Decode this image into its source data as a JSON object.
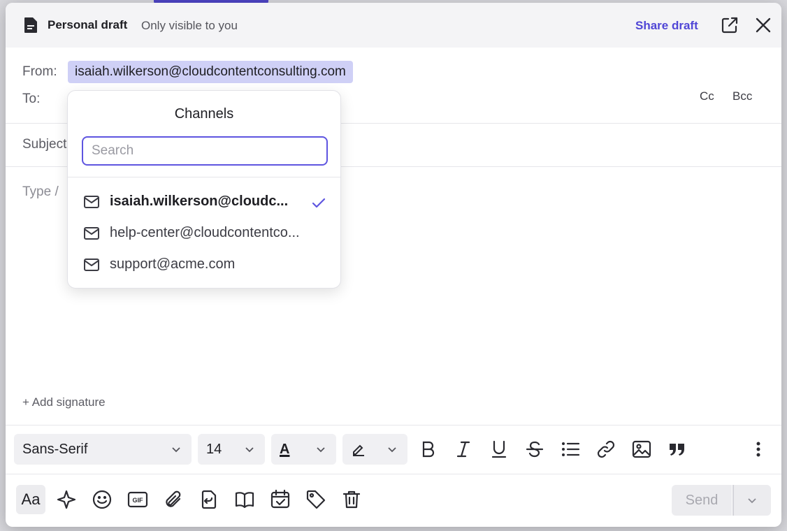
{
  "header": {
    "title": "Personal draft",
    "subtitle": "Only visible to you",
    "share_label": "Share draft"
  },
  "compose": {
    "from_label": "From:",
    "from_value": "isaiah.wilkerson@cloudcontentconsulting.com",
    "to_label": "To:",
    "cc_label": "Cc",
    "bcc_label": "Bcc",
    "subject_label": "Subject",
    "body_placeholder": "Type /",
    "add_signature": "+ Add signature"
  },
  "channels_dropdown": {
    "title": "Channels",
    "search_placeholder": "Search",
    "items": [
      {
        "label": "isaiah.wilkerson@cloudc...",
        "selected": true
      },
      {
        "label": "help-center@cloudcontentco...",
        "selected": false
      },
      {
        "label": "support@acme.com",
        "selected": false
      }
    ]
  },
  "toolbar": {
    "font_family": "Sans-Serif",
    "font_size": "14",
    "text_color_glyph": "A",
    "icons": [
      "bold-icon",
      "italic-icon",
      "underline-icon",
      "strikethrough-icon",
      "bullet-list-icon",
      "link-icon",
      "image-icon",
      "quote-icon",
      "more-vertical-icon"
    ]
  },
  "bottom_bar": {
    "format_label": "Aa",
    "send_label": "Send",
    "icons": [
      "sparkle-icon",
      "emoji-icon",
      "gif-icon",
      "attachment-icon",
      "template-icon",
      "knowledge-book-icon",
      "schedule-icon",
      "tag-icon",
      "trash-icon"
    ]
  },
  "colors": {
    "accent": "#5046d6",
    "chip_bg": "#cfd0f6",
    "header_bg": "#f4f4f6"
  }
}
